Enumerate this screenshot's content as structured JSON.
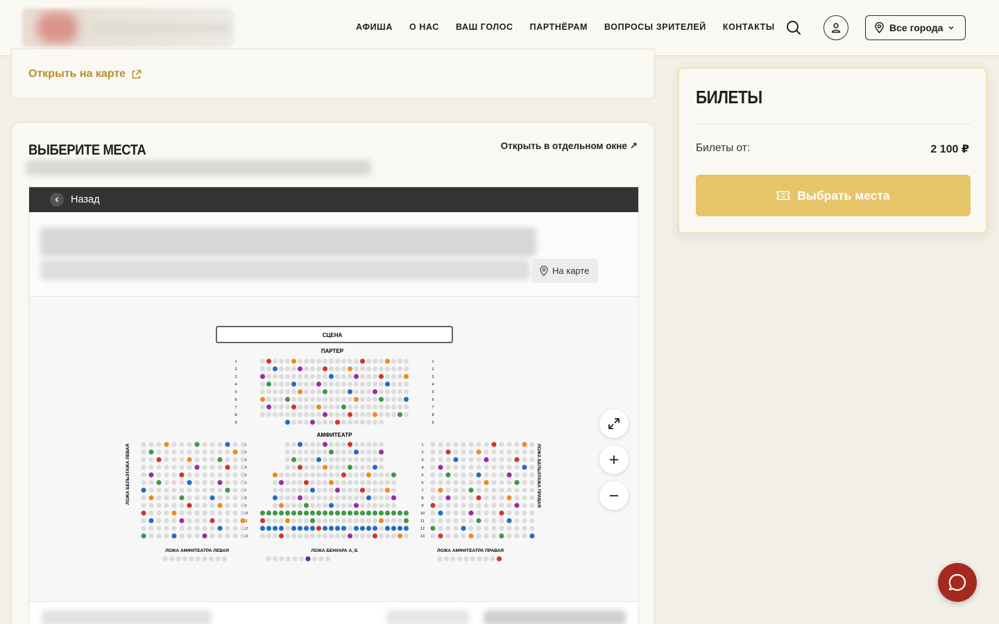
{
  "nav": {
    "items": [
      "АФИША",
      "О НАС",
      "ВАШ ГОЛОС",
      "ПАРТНЁРАМ",
      "ВОПРОСЫ ЗРИТЕЛЕЙ",
      "КОНТАКТЫ"
    ],
    "city": "Все города"
  },
  "venue": {
    "open_map": "Открыть на карте"
  },
  "seats_section": {
    "title": "ВЫБЕРИТЕ МЕСТА",
    "open_window": "Открыть в отдельном окне ↗",
    "back": "Назад",
    "on_map": "На карте"
  },
  "hall": {
    "stage": "СЦЕНА",
    "parter": "ПАРТЕР",
    "amphi": "АМФИТЕАТР",
    "loge_left": "ЛОЖА БЕЛЬЭТАЖА ЛЕВАЯ",
    "loge_right": "ЛОЖА БЕЛЬЭТАЖА ПРАВАЯ",
    "box_amphi_left": "ЛОЖА АМФИТЕАТРА ЛЕВАЯ",
    "box_benoir": "ЛОЖА БЕНУАРА А, Б",
    "box_amphi_right": "ЛОЖА АМФИТЕАТРА ПРАВАЯ",
    "colors": {
      "free": "#dcdcdc",
      "green": "#3d9a45",
      "orange": "#ef8a1e",
      "red": "#d2342a",
      "purple": "#9d2aa6",
      "darkpurple": "#6a2aa0",
      "blue": "#1f6fc2",
      "lightblue": "#2b9be0"
    }
  },
  "tickets": {
    "title": "БИЛЕТЫ",
    "from_label": "Билеты от:",
    "price": "2 100 ₽",
    "choose": "Выбрать места"
  }
}
